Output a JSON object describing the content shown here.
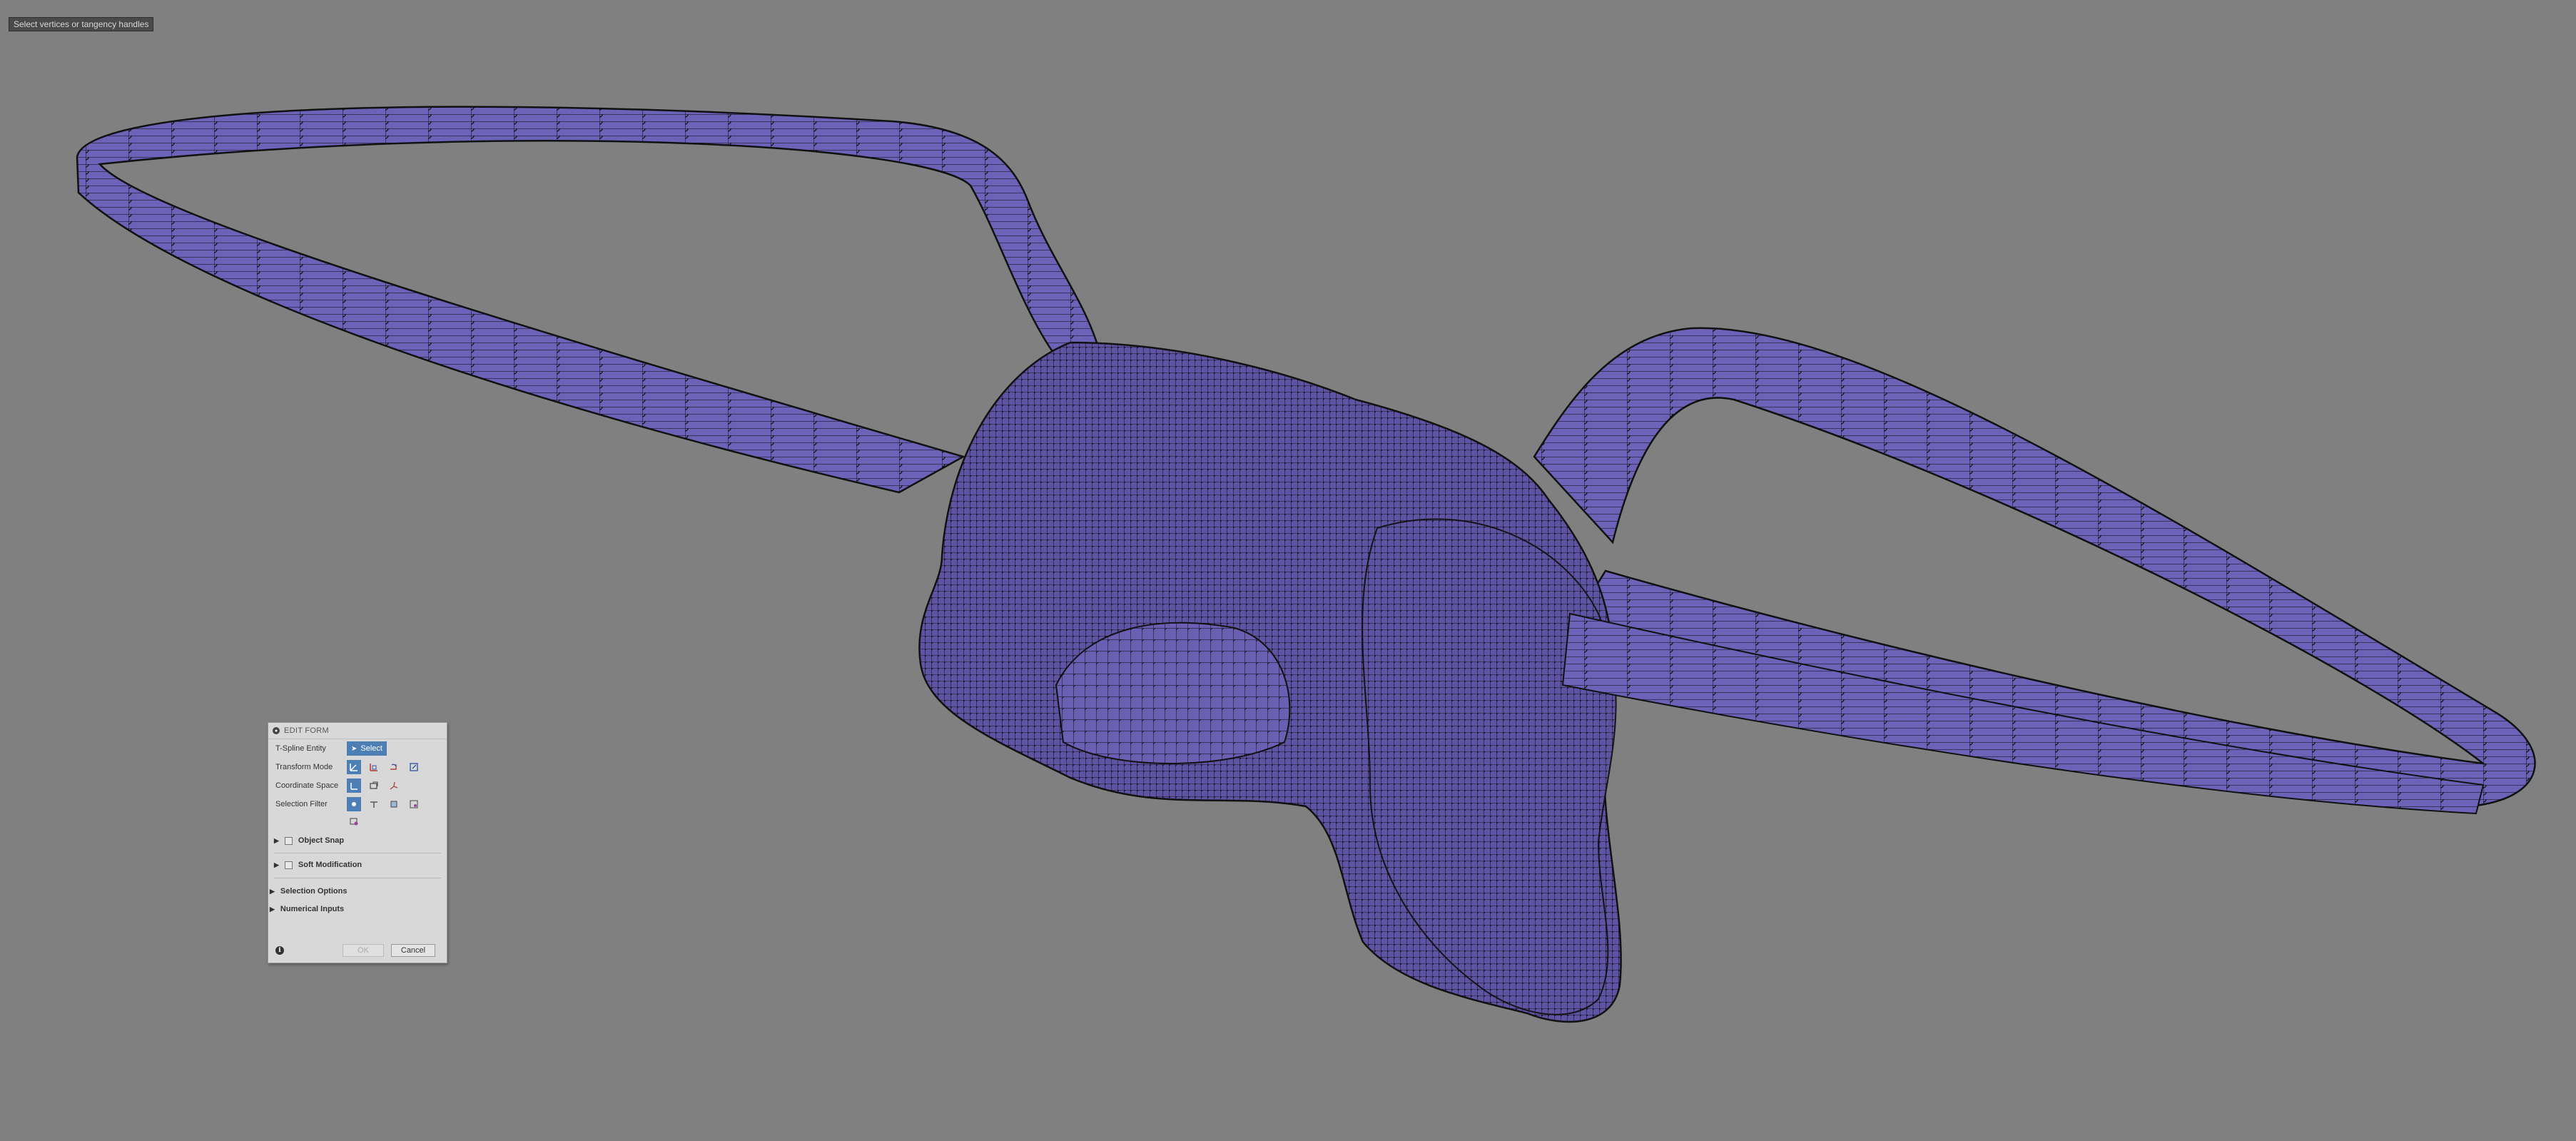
{
  "tooltip": "Select vertices or tangency handles",
  "panel": {
    "title": "EDIT FORM",
    "rows": {
      "tspline_entity": {
        "label": "T-Spline Entity",
        "button": "Select"
      },
      "transform_mode": {
        "label": "Transform Mode"
      },
      "coordinate_space": {
        "label": "Coordinate Space"
      },
      "selection_filter": {
        "label": "Selection Filter"
      }
    },
    "sections": {
      "object_snap": "Object Snap",
      "soft_modification": "Soft Modification",
      "selection_options": "Selection Options",
      "numerical_inputs": "Numerical Inputs"
    },
    "footer": {
      "ok": "OK",
      "cancel": "Cancel"
    }
  },
  "colors": {
    "background": "#808080",
    "mesh_fill": "#6a5fb3",
    "mesh_lines": "#1a1a2a",
    "accent_button": "#4d7fb5"
  },
  "icons": [
    "move-icon",
    "rotate-icon",
    "scale-icon",
    "select-arrow-icon",
    "info-icon"
  ]
}
